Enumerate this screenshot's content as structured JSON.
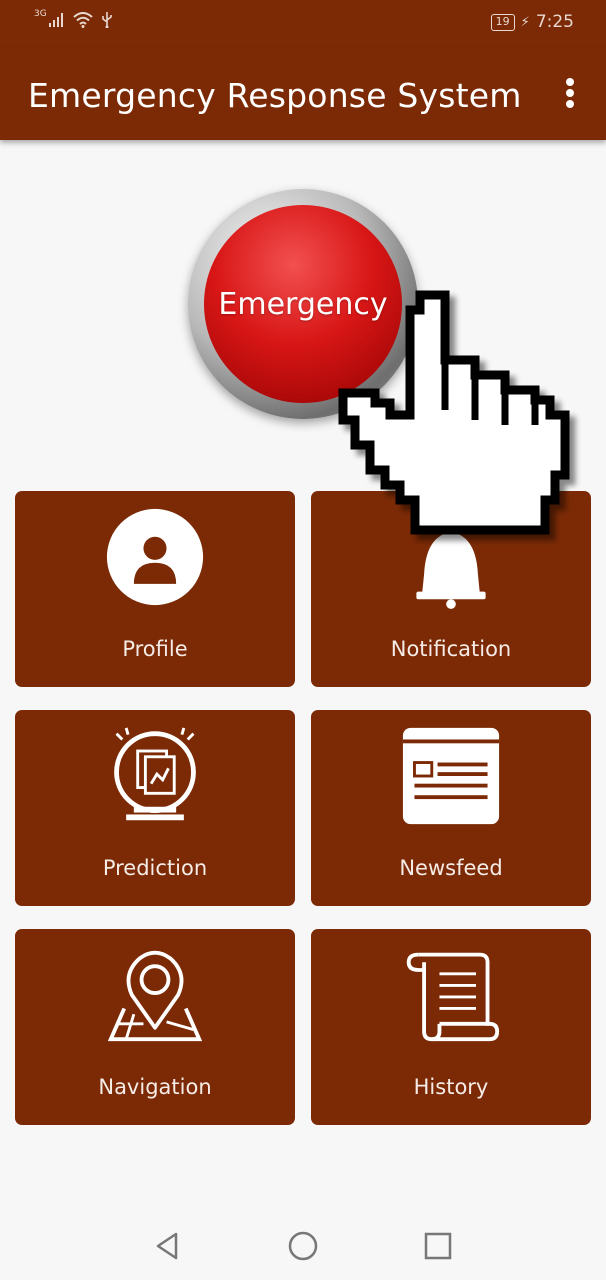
{
  "status_bar": {
    "network": "3G",
    "battery": "19",
    "time": "7:25"
  },
  "app_bar": {
    "title": "Emergency Response System",
    "menu_icon": "more-vert-icon"
  },
  "emergency": {
    "label": "Emergency",
    "color": "#d81616"
  },
  "tiles": [
    {
      "label": "Profile",
      "icon": "person-icon"
    },
    {
      "label": "Notification",
      "icon": "bell-icon"
    },
    {
      "label": "Prediction",
      "icon": "crystal-ball-chart-icon"
    },
    {
      "label": "Newsfeed",
      "icon": "newspaper-icon"
    },
    {
      "label": "Navigation",
      "icon": "map-pin-icon"
    },
    {
      "label": "History",
      "icon": "scroll-icon"
    }
  ],
  "nav_bar": {
    "back": "back-triangle-icon",
    "home": "home-circle-icon",
    "recents": "recents-square-icon"
  },
  "colors": {
    "primary": "#7b2a05",
    "background": "#f7f7f7"
  }
}
